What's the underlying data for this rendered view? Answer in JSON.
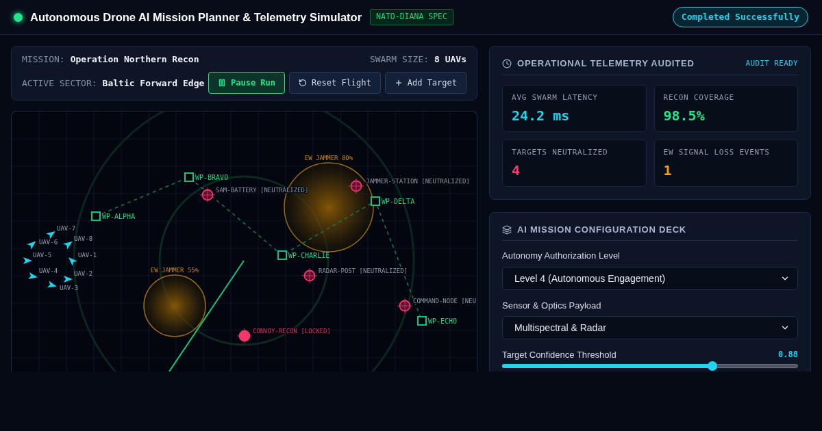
{
  "header": {
    "title": "Autonomous Drone AI Mission Planner & Telemetry Simulator",
    "badge": "NATO-DIANA SPEC",
    "status": "Completed Successfully"
  },
  "mission": {
    "fields": [
      {
        "label": "MISSION:",
        "value": "Operation Northern Recon"
      },
      {
        "label": "SWARM SIZE:",
        "value": "8 UAVs"
      },
      {
        "label": "ACTIVE SECTOR:",
        "value": "Baltic Forward Edge"
      }
    ],
    "buttons": [
      {
        "label": "Pause Run",
        "active": true
      },
      {
        "label": "Reset Flight",
        "active": false
      },
      {
        "label": "Add Target",
        "active": false
      }
    ]
  },
  "map": {
    "waypoints": [
      {
        "label": "WP-ALPHA"
      },
      {
        "label": "WP-BRAVO"
      },
      {
        "label": "WP-CHARLIE"
      },
      {
        "label": "WP-DELTA"
      },
      {
        "label": "WP-ECHO"
      }
    ],
    "targets": [
      {
        "label": "SAM-BATTERY [NEUTRALIZED]",
        "kind": "neutralized"
      },
      {
        "label": "JAMMER-STATION [NEUTRALIZED]",
        "kind": "neutralized"
      },
      {
        "label": "RADAR-POST [NEUTRALIZED]",
        "kind": "neutralized"
      },
      {
        "label": "COMMAND-NODE [NEU",
        "kind": "neutralized"
      },
      {
        "label": "CONVOY-RECON [LOCKED]",
        "kind": "locked"
      }
    ],
    "jammers": [
      {
        "label": "EW JAMMER 80%"
      },
      {
        "label": "EW JAMMER 55%"
      }
    ],
    "drones": [
      {
        "label": "UAV-7"
      },
      {
        "label": "UAV-6"
      },
      {
        "label": "UAV-8"
      },
      {
        "label": "UAV-5"
      },
      {
        "label": "UAV-1"
      },
      {
        "label": "UAV-4"
      },
      {
        "label": "UAV-2"
      },
      {
        "label": "UAV-3"
      }
    ]
  },
  "telemetry": {
    "title": "OPERATIONAL TELEMETRY AUDITED",
    "badge": "AUDIT READY",
    "stats": [
      {
        "label": "AVG SWARM LATENCY",
        "value": "24.2 ms",
        "color": "#22d3ee"
      },
      {
        "label": "RECON COVERAGE",
        "value": "98.5%",
        "color": "#20e88a"
      },
      {
        "label": "TARGETS NEUTRALIZED",
        "value": "4",
        "color": "#f43f6e"
      },
      {
        "label": "EW SIGNAL LOSS EVENTS",
        "value": "1",
        "color": "#f5a30b"
      }
    ]
  },
  "config": {
    "title": "AI MISSION CONFIGURATION DECK",
    "selects": [
      {
        "label": "Autonomy Authorization Level",
        "value": "Level 4 (Autonomous Engagement)"
      },
      {
        "label": "Sensor & Optics Payload",
        "value": "Multispectral & Radar"
      }
    ],
    "slider": {
      "label": "Target Confidence Threshold",
      "reading": "0.88",
      "level": 0.71
    }
  }
}
